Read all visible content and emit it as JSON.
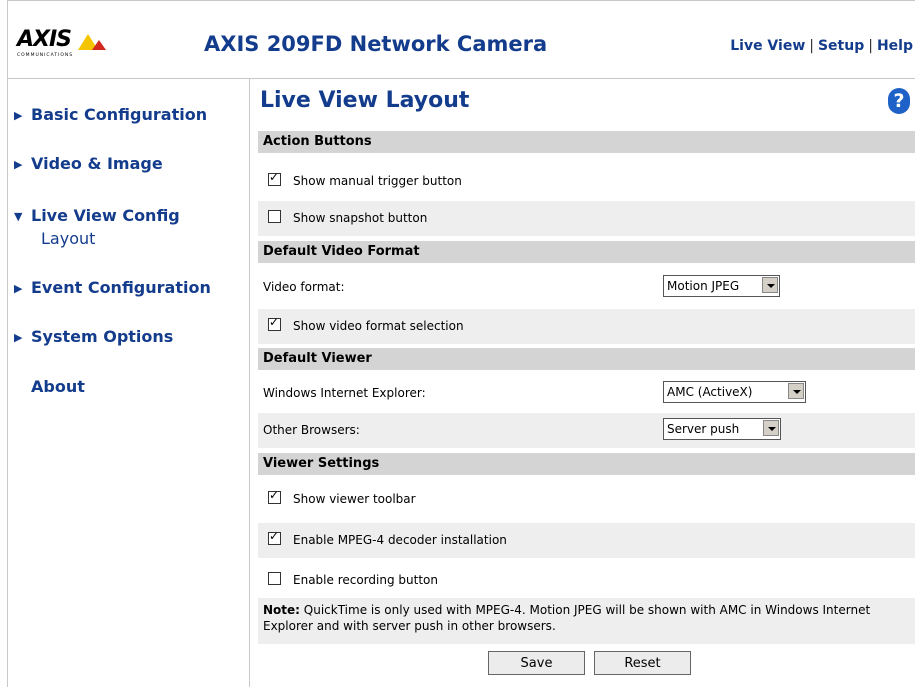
{
  "header": {
    "logo_text": "AXIS",
    "logo_sub": "COMMUNICATIONS",
    "app_title": "AXIS 209FD Network Camera",
    "nav": {
      "live_view": "Live View",
      "setup": "Setup",
      "help": "Help",
      "sep": "|"
    }
  },
  "sidebar": {
    "items": [
      {
        "label": "Basic Configuration",
        "arrow": "▶"
      },
      {
        "label": "Video & Image",
        "arrow": "▶"
      },
      {
        "label": "Live View Config",
        "arrow": "▼"
      },
      {
        "label": "Event Configuration",
        "arrow": "▶"
      },
      {
        "label": "System Options",
        "arrow": "▶"
      },
      {
        "label": "About"
      }
    ],
    "sub_item": "Layout"
  },
  "main": {
    "title": "Live View Layout",
    "help_icon": "?",
    "sections": {
      "action_buttons": "Action Buttons",
      "default_video_format": "Default Video Format",
      "default_viewer": "Default Viewer",
      "viewer_settings": "Viewer Settings"
    },
    "options": {
      "manual_trigger": {
        "label": "Show manual trigger button",
        "checked": true
      },
      "snapshot": {
        "label": "Show snapshot button",
        "checked": false
      },
      "video_format_selection": {
        "label": "Show video format selection",
        "checked": true
      },
      "viewer_toolbar": {
        "label": "Show viewer toolbar",
        "checked": true
      },
      "mpeg4_decoder": {
        "label": "Enable MPEG-4 decoder installation",
        "checked": true
      },
      "recording_button": {
        "label": "Enable recording button",
        "checked": false
      }
    },
    "video_format": {
      "label": "Video format:",
      "value": "Motion JPEG"
    },
    "ie_viewer": {
      "label": "Windows Internet Explorer:",
      "value": "AMC (ActiveX)"
    },
    "other_viewer": {
      "label": "Other Browsers:",
      "value": "Server push"
    },
    "note": {
      "bold": "Note:",
      "text": " QuickTime is only used with MPEG-4. Motion JPEG will be shown with AMC in Windows Internet Explorer and with server push in other browsers."
    },
    "buttons": {
      "save": "Save",
      "reset": "Reset"
    },
    "check_mark": "✓"
  },
  "colors": {
    "accent": "#143c8c",
    "section_bg": "#d4d4d4",
    "row_shade": "#eeeeee",
    "logo_yellow": "#f5c400",
    "logo_red": "#d2281e"
  }
}
